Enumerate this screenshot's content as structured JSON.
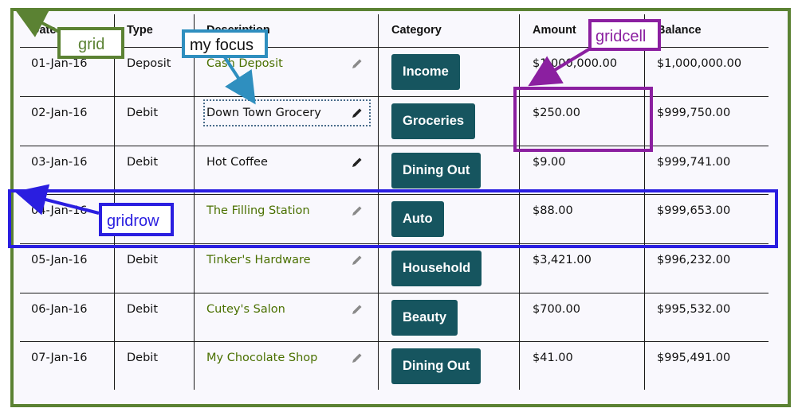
{
  "grid": {
    "headers": {
      "date": "Date",
      "type": "Type",
      "description": "Description",
      "category": "Category",
      "amount": "Amount",
      "balance": "Balance"
    },
    "rows": [
      {
        "date": "01-Jan-16",
        "type": "Deposit",
        "description": "Cash Deposit",
        "category": "Income",
        "amount": "$1,000,000.00",
        "balance": "$1,000,000.00"
      },
      {
        "date": "02-Jan-16",
        "type": "Debit",
        "description": "Down Town Grocery",
        "category": "Groceries",
        "amount": "$250.00",
        "balance": "$999,750.00"
      },
      {
        "date": "03-Jan-16",
        "type": "Debit",
        "description": "Hot Coffee",
        "category": "Dining Out",
        "amount": "$9.00",
        "balance": "$999,741.00"
      },
      {
        "date": "04-Jan-16",
        "type": "Debit",
        "description": "The Filling Station",
        "category": "Auto",
        "amount": "$88.00",
        "balance": "$999,653.00"
      },
      {
        "date": "05-Jan-16",
        "type": "Debit",
        "description": "Tinker's Hardware",
        "category": "Household",
        "amount": "$3,421.00",
        "balance": "$996,232.00"
      },
      {
        "date": "06-Jan-16",
        "type": "Debit",
        "description": "Cutey's Salon",
        "category": "Beauty",
        "amount": "$700.00",
        "balance": "$995,532.00"
      },
      {
        "date": "07-Jan-16",
        "type": "Debit",
        "description": "My Chocolate Shop",
        "category": "Dining Out",
        "amount": "$41.00",
        "balance": "$995,491.00"
      }
    ]
  },
  "annotations": {
    "grid": "grid",
    "focus": "my focus",
    "gridcell": "gridcell",
    "gridrow": "gridrow"
  },
  "colors": {
    "grid_annotation": "#5b8233",
    "focus_annotation": "#2f8fbf",
    "gridcell_annotation": "#8b1fa0",
    "gridrow_annotation": "#2a1ee0",
    "category_button": "#16555f",
    "link_text": "#4a7000"
  },
  "icons": {
    "edit": "pencil-icon"
  }
}
